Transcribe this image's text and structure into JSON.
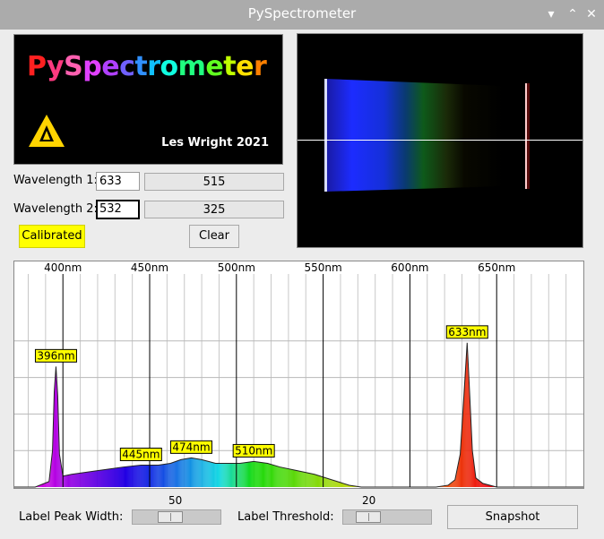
{
  "window": {
    "title": "PySpectrometer",
    "min_glyph": "▾",
    "max_glyph": "⌃",
    "close_glyph": "✕"
  },
  "logo": {
    "brand_letters": [
      "P",
      "y",
      "S",
      "p",
      "e",
      "c",
      "t",
      "r",
      "o",
      "m",
      "e",
      "t",
      "e",
      "r"
    ],
    "brand_colors": [
      "#ff2020",
      "#ff3a80",
      "#ff60b0",
      "#e040ff",
      "#b040ff",
      "#7060ff",
      "#3090ff",
      "#10c0ff",
      "#10ffe0",
      "#20ff80",
      "#60ff20",
      "#c0ff00",
      "#ffe000",
      "#ff8000"
    ],
    "author": "Les Wright 2021"
  },
  "calibration": {
    "w1_label": "Wavelength 1:",
    "w1_value": "633",
    "w1_pixel": "515",
    "w2_label": "Wavelength 2:",
    "w2_value": "532",
    "w2_pixel": "325",
    "calibrated_label": "Calibrated",
    "clear_label": "Clear"
  },
  "controls": {
    "peak_width_label": "Label Peak Width:",
    "peak_width_value": "50",
    "peak_width_fraction": 0.4,
    "threshold_label": "Label Threshold:",
    "threshold_value": "20",
    "threshold_fraction": 0.2,
    "snapshot_label": "Snapshot"
  },
  "chart_data": {
    "type": "area",
    "x_ticks": [
      "400nm",
      "450nm",
      "500nm",
      "550nm",
      "600nm",
      "650nm"
    ],
    "x_tick_values": [
      400,
      450,
      500,
      550,
      600,
      650
    ],
    "xlim": [
      372,
      700
    ],
    "ylim": [
      0,
      100
    ],
    "peaks": [
      {
        "label": "396nm",
        "x": 396,
        "y": 66
      },
      {
        "label": "445nm",
        "x": 445,
        "y": 12
      },
      {
        "label": "474nm",
        "x": 474,
        "y": 16
      },
      {
        "label": "510nm",
        "x": 510,
        "y": 14
      },
      {
        "label": "633nm",
        "x": 633,
        "y": 79
      }
    ],
    "spectrum": [
      [
        372,
        0
      ],
      [
        384,
        0
      ],
      [
        392,
        3
      ],
      [
        394,
        20
      ],
      [
        395,
        52
      ],
      [
        396,
        66
      ],
      [
        397,
        50
      ],
      [
        398,
        18
      ],
      [
        400,
        6
      ],
      [
        405,
        7
      ],
      [
        420,
        9
      ],
      [
        435,
        11
      ],
      [
        445,
        12
      ],
      [
        455,
        12
      ],
      [
        462,
        13
      ],
      [
        468,
        15
      ],
      [
        474,
        16
      ],
      [
        480,
        15
      ],
      [
        488,
        13
      ],
      [
        495,
        13
      ],
      [
        502,
        13
      ],
      [
        510,
        14
      ],
      [
        518,
        13
      ],
      [
        525,
        11
      ],
      [
        535,
        9
      ],
      [
        545,
        7
      ],
      [
        555,
        4
      ],
      [
        565,
        1
      ],
      [
        572,
        0
      ],
      [
        615,
        0
      ],
      [
        622,
        1
      ],
      [
        626,
        4
      ],
      [
        629,
        18
      ],
      [
        631,
        48
      ],
      [
        633,
        79
      ],
      [
        634,
        60
      ],
      [
        636,
        20
      ],
      [
        638,
        5
      ],
      [
        642,
        2
      ],
      [
        650,
        0
      ],
      [
        700,
        0
      ]
    ]
  }
}
